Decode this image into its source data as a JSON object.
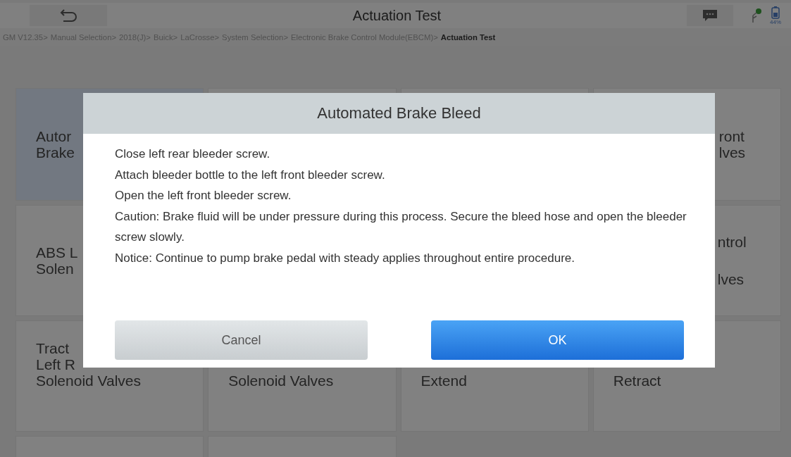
{
  "header": {
    "title": "Actuation Test",
    "battery_text": "44%"
  },
  "breadcrumb": [
    {
      "label": "GM V12.35>",
      "selected": false
    },
    {
      "label": "Manual Selection>",
      "selected": false
    },
    {
      "label": "2018(J)>",
      "selected": false
    },
    {
      "label": "Buick>",
      "selected": false
    },
    {
      "label": "LaCrosse>",
      "selected": false
    },
    {
      "label": "System Selection>",
      "selected": false
    },
    {
      "label": "Electronic Brake Control Module(EBCM)>",
      "selected": false
    },
    {
      "label": "Actuation Test",
      "selected": true
    }
  ],
  "tile_rows": [
    {
      "tiles": [
        {
          "kind": "left",
          "selected": true,
          "lines": [
            "Autor",
            "Brake"
          ]
        },
        {
          "kind": "hidden"
        },
        {
          "kind": "hidden"
        },
        {
          "kind": "right",
          "selected": false,
          "lines": [
            "ront",
            "lves"
          ]
        }
      ]
    },
    {
      "tiles": [
        {
          "kind": "left",
          "selected": false,
          "lines": [
            "ABS L",
            "Solen"
          ]
        },
        {
          "kind": "hidden"
        },
        {
          "kind": "hidden"
        },
        {
          "kind": "right-spread",
          "selected": false,
          "lines": [
            "ntrol",
            "lves"
          ]
        }
      ]
    },
    {
      "tiles": [
        {
          "kind": "bottom",
          "selected": false,
          "lines": [
            "Tract",
            "Left R",
            "Solenoid Valves"
          ]
        },
        {
          "kind": "bottom",
          "selected": false,
          "lines": [
            "Solenoid Valves"
          ]
        },
        {
          "kind": "bottom",
          "selected": false,
          "lines": [
            "Extend"
          ]
        },
        {
          "kind": "bottom",
          "selected": false,
          "lines": [
            "Retract"
          ]
        }
      ]
    },
    {
      "tiles": [
        {
          "kind": "hidden"
        },
        {
          "kind": "hidden"
        }
      ]
    }
  ],
  "dialog": {
    "title": "Automated Brake Bleed",
    "paragraphs": [
      "Close left rear bleeder screw.",
      "Attach bleeder bottle to the left front bleeder screw.",
      "Open the left front bleeder screw.",
      "Caution: Brake fluid will be under pressure during this process. Secure the bleed hose and open the bleeder screw slowly.",
      "Notice: Continue to pump brake pedal with steady applies throughout entire procedure."
    ],
    "buttons": [
      {
        "label": "Cancel",
        "kind": "secondary"
      },
      {
        "label": "OK",
        "kind": "primary"
      }
    ]
  }
}
